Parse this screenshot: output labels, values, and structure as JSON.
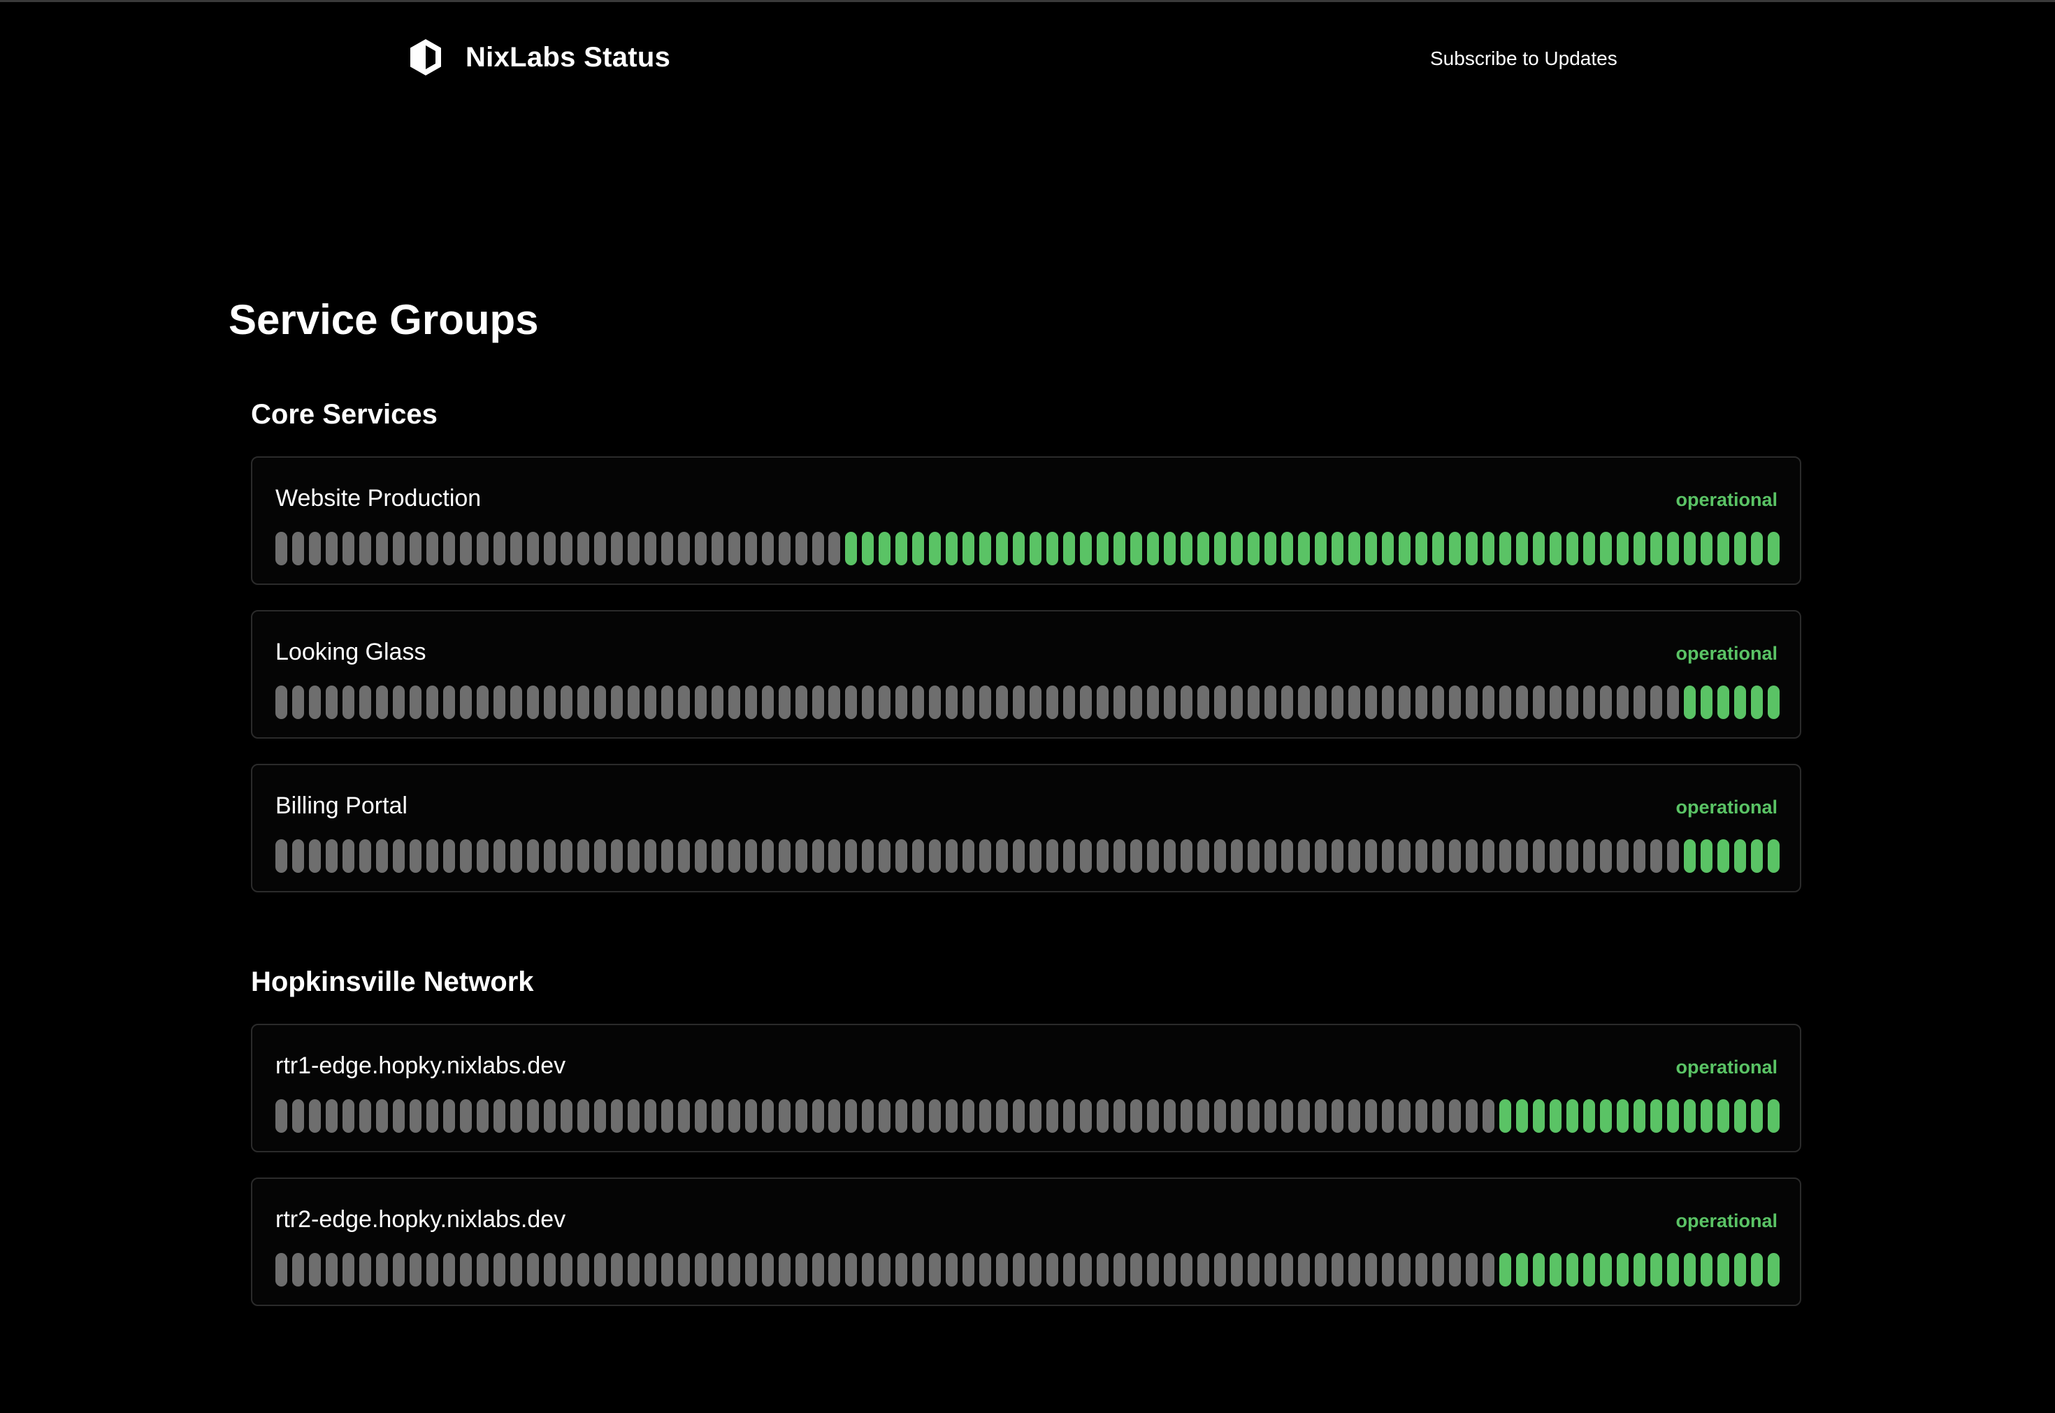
{
  "header": {
    "title": "NixLabs Status",
    "logo_icon": "hexagon-half-icon",
    "subscribe_label": "Subscribe to Updates"
  },
  "main": {
    "page_title": "Service Groups",
    "groups": [
      {
        "name": "Core Services",
        "services": [
          {
            "name": "Website Production",
            "status": "operational",
            "total_days": 90,
            "operational_days": 56
          },
          {
            "name": "Looking Glass",
            "status": "operational",
            "total_days": 90,
            "operational_days": 6
          },
          {
            "name": "Billing Portal",
            "status": "operational",
            "total_days": 90,
            "operational_days": 6
          }
        ]
      },
      {
        "name": "Hopkinsville Network",
        "services": [
          {
            "name": "rtr1-edge.hopky.nixlabs.dev",
            "status": "operational",
            "total_days": 90,
            "operational_days": 17
          },
          {
            "name": "rtr2-edge.hopky.nixlabs.dev",
            "status": "operational",
            "total_days": 90,
            "operational_days": 17
          }
        ]
      }
    ]
  },
  "colors": {
    "background": "#000000",
    "operational": "#5ac365",
    "no_data": "#6e6e6e",
    "card_border": "#2b2b2b",
    "text": "#ffffff"
  }
}
